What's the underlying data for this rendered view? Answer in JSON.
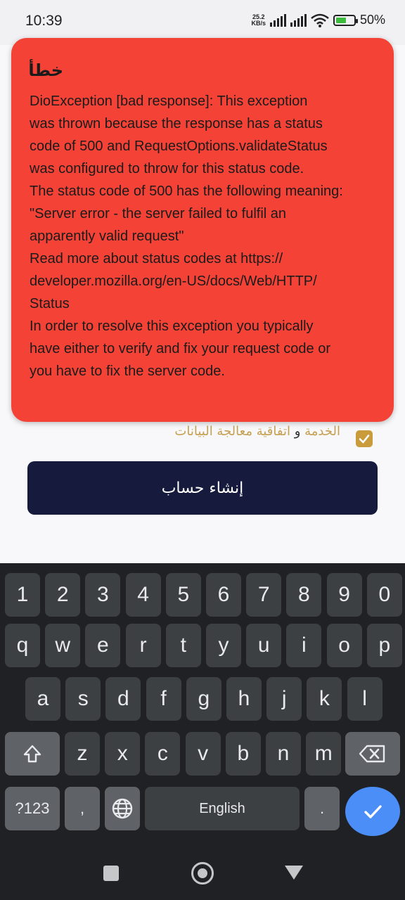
{
  "status_bar": {
    "time": "10:39",
    "net_speed_value": "25.2",
    "net_speed_unit": "KB/s",
    "battery": "50%"
  },
  "form": {
    "consent_link_1": "الخدمة",
    "consent_and": " و ",
    "consent_link_2": "اتفاقية معالجة البيانات",
    "create_button": "إنشاء حساب"
  },
  "error_dialog": {
    "title": "خطأ",
    "message": "DioException [bad response]: This exception\nwas thrown because the response has a status\ncode of 500 and RequestOptions.validateStatus\nwas configured to throw for this status code.\nThe status code of 500 has the following meaning:\n\"Server error - the server failed to fulfil an\napparently valid request\"\nRead more about status codes at https://\ndeveloper.mozilla.org/en-US/docs/Web/HTTP/\nStatus\nIn order to resolve this exception you typically\nhave either to verify and fix your request code or\nyou have to fix the server code."
  },
  "keyboard": {
    "row_numbers": [
      "1",
      "2",
      "3",
      "4",
      "5",
      "6",
      "7",
      "8",
      "9",
      "0"
    ],
    "row_top": [
      "q",
      "w",
      "e",
      "r",
      "t",
      "y",
      "u",
      "i",
      "o",
      "p"
    ],
    "row_middle": [
      "a",
      "s",
      "d",
      "f",
      "g",
      "h",
      "j",
      "k",
      "l"
    ],
    "row_bottom": [
      "z",
      "x",
      "c",
      "v",
      "b",
      "n",
      "m"
    ],
    "symbols_key": "?123",
    "comma_key": ",",
    "space_label": "English",
    "period_key": "."
  },
  "colors": {
    "error_background": "#f44336",
    "primary_button": "#161a3c",
    "accent_gold": "#c99b3b",
    "keyboard_background": "#202124",
    "enter_key": "#4b8ef7"
  }
}
